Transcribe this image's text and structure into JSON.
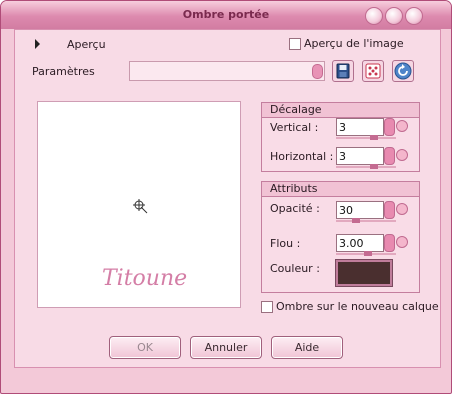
{
  "window": {
    "title": "Ombre portée"
  },
  "preview": {
    "toggle_label": "Aperçu",
    "image_checkbox_label": "Aperçu de l'image",
    "watermark": "Titoune"
  },
  "params": {
    "label": "Paramètres",
    "preset_value": ""
  },
  "offset": {
    "title": "Décalage",
    "vertical_label": "Vertical :",
    "vertical_value": "3",
    "horizontal_label": "Horizontal :",
    "horizontal_value": "3"
  },
  "attributes": {
    "title": "Attributs",
    "opacity_label": "Opacité :",
    "opacity_value": "30",
    "blur_label": "Flou :",
    "blur_value": "3.00",
    "color_label": "Couleur :",
    "color": "#4a2f2f"
  },
  "new_layer_label": "Ombre sur le nouveau calque",
  "buttons": {
    "ok": "OK",
    "cancel": "Annuler",
    "help": "Aide"
  },
  "icons": {
    "save": "floppy-save-icon",
    "random": "dice-icon",
    "reset": "reset-arrow-icon"
  },
  "colors": {
    "accent": "#d27ca2",
    "panel": "#f8dbe6"
  }
}
